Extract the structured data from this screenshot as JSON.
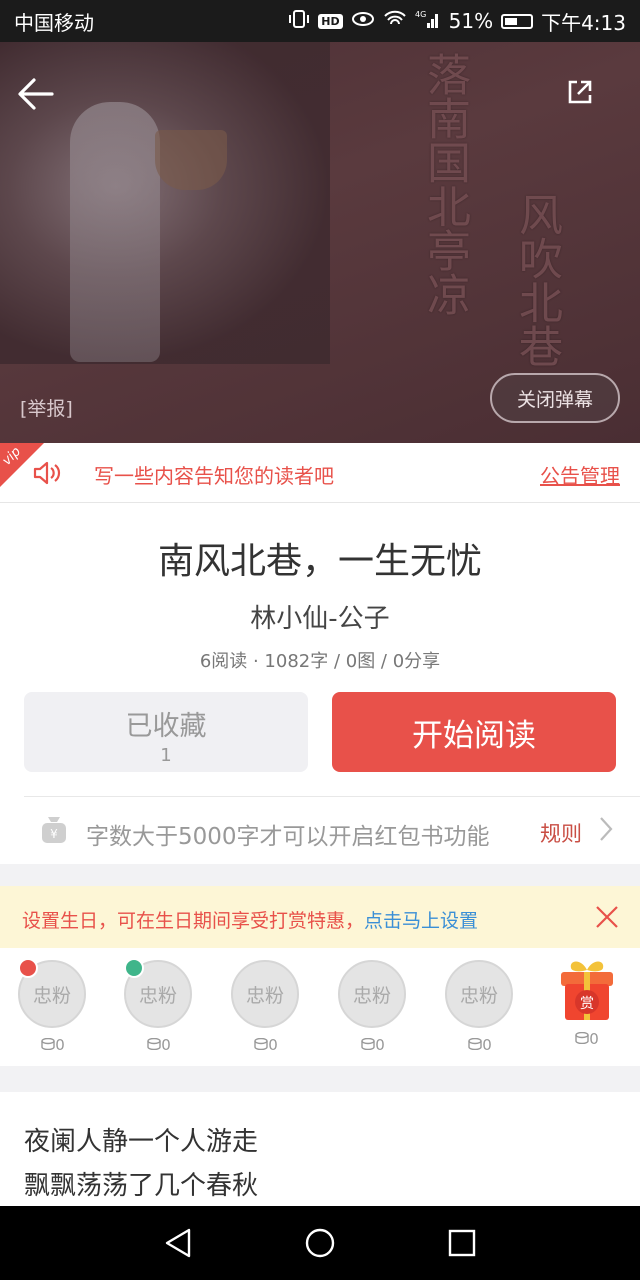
{
  "status_bar": {
    "carrier": "中国移动",
    "network": "4G",
    "battery": "51%",
    "battery_level": 0.51,
    "time": "下午4:13",
    "hd_badge": "HD"
  },
  "hero": {
    "calligraphy_left": "落南国北亭凉",
    "calligraphy_right": "风吹北巷",
    "report_label": "[举报]",
    "close_danmaku_label": "关闭弹幕"
  },
  "notice": {
    "vip_label": "vip",
    "text": "写一些内容告知您的读者吧",
    "manage_label": "公告管理"
  },
  "book": {
    "title": "南风北巷，一生无忧",
    "author": "林小仙-公子",
    "stats": "6阅读 · 1082字 / 0图 / 0分享"
  },
  "actions": {
    "favorite_label": "已收藏",
    "favorite_count": "1",
    "start_read_label": "开始阅读"
  },
  "red_packet": {
    "text": "字数大于5000字才可以开启红包书功能",
    "rule_label": "规则"
  },
  "birthday": {
    "text": "设置生日，可在生日期间享受打赏特惠，",
    "link": "点击马上设置"
  },
  "fans": {
    "items": [
      {
        "label": "忠粉",
        "amount": "0"
      },
      {
        "label": "忠粉",
        "amount": "0"
      },
      {
        "label": "忠粉",
        "amount": "0"
      },
      {
        "label": "忠粉",
        "amount": "0"
      },
      {
        "label": "忠粉",
        "amount": "0"
      }
    ],
    "gift": {
      "label": "赏",
      "amount": "0"
    }
  },
  "content": {
    "lines": [
      "夜阑人静一个人游走",
      "飘飘荡荡了几个春秋"
    ]
  },
  "colors": {
    "accent": "#e8514a",
    "link": "#3a8fd6",
    "banner_bg": "#fdf6d6"
  }
}
